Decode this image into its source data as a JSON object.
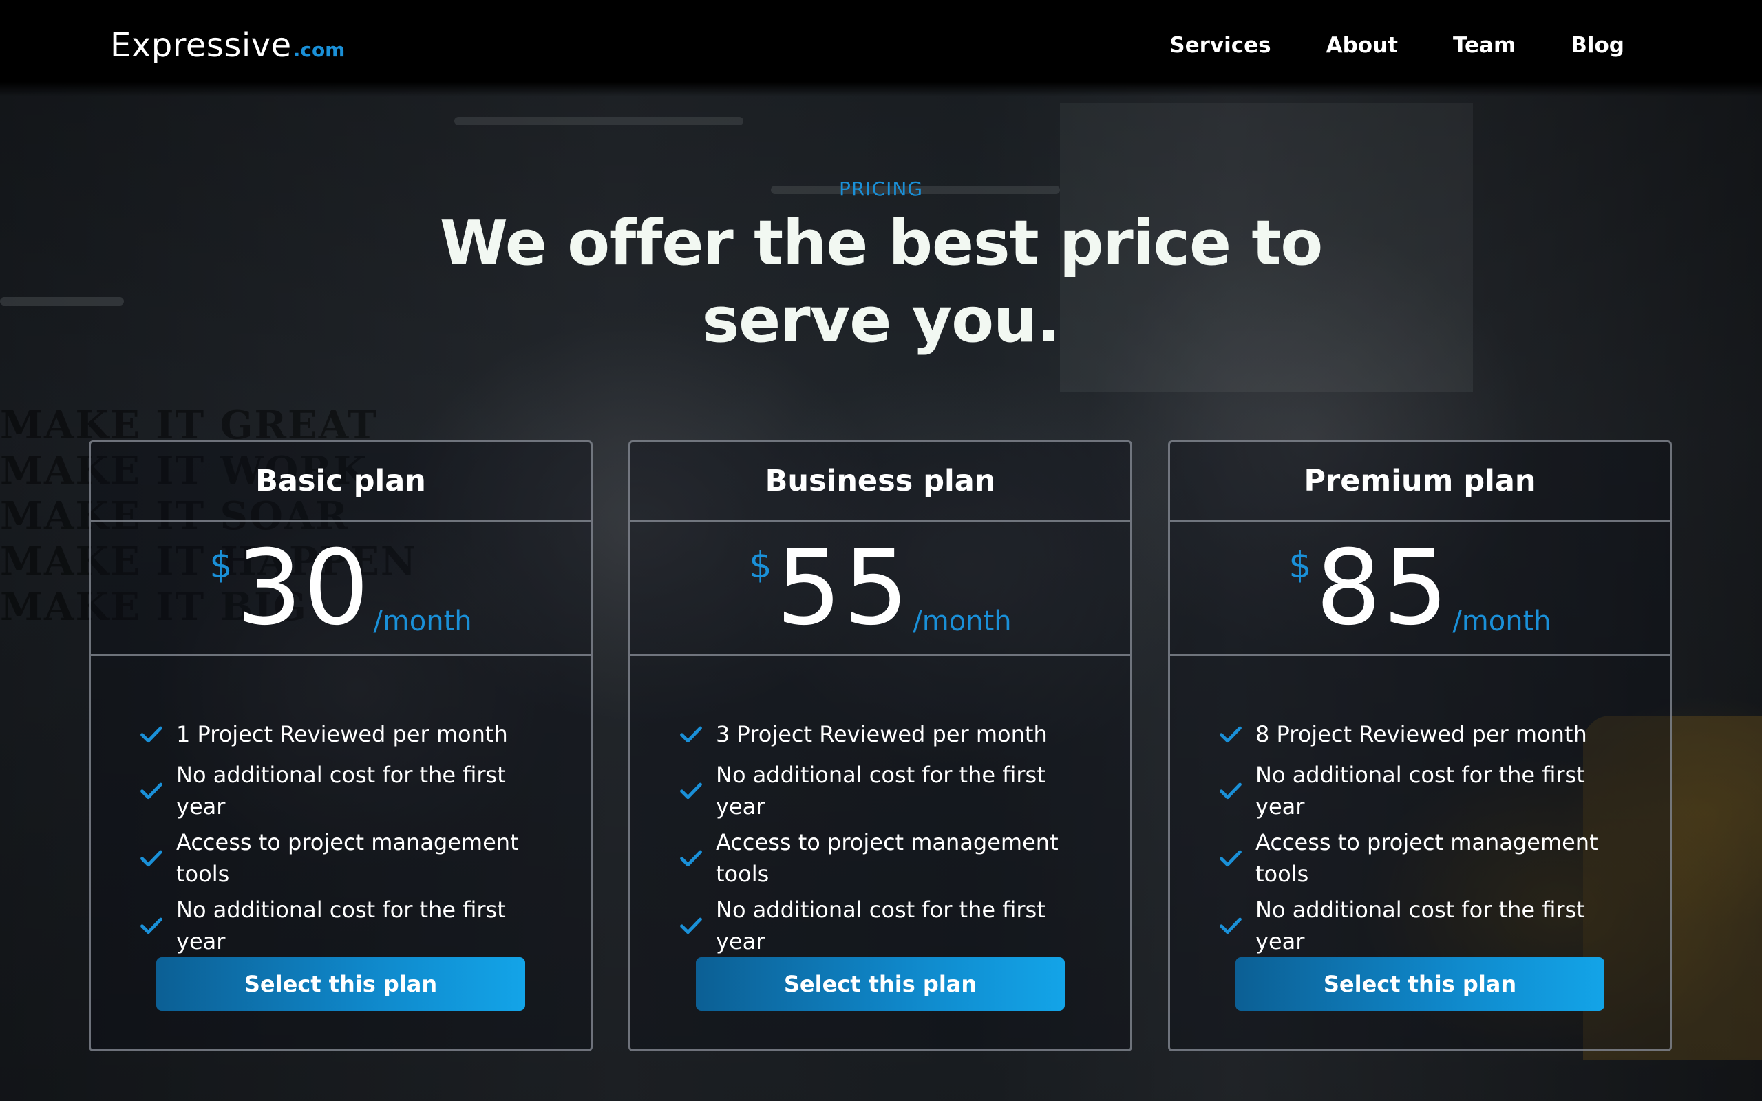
{
  "brand": {
    "name": "Expressive",
    "tld": ".com"
  },
  "nav": [
    {
      "label": "Services"
    },
    {
      "label": "About"
    },
    {
      "label": "Team"
    },
    {
      "label": "Blog"
    }
  ],
  "hero": {
    "eyebrow": "PRICING",
    "headline": "We offer the best price to serve you."
  },
  "colors": {
    "accent": "#1a90d8",
    "headline": "#f2f8f2"
  },
  "plans": [
    {
      "title": "Basic plan",
      "currency": "$",
      "amount": "30",
      "period": "/month",
      "features": [
        "1 Project Reviewed per month",
        "No additional cost for the first year",
        "Access to project management tools",
        "No additional cost for the first year"
      ],
      "button": "Select this plan"
    },
    {
      "title": "Business plan",
      "currency": "$",
      "amount": "55",
      "period": "/month",
      "features": [
        "3 Project Reviewed per month",
        "No additional cost for the first year",
        "Access to project management tools",
        "No additional cost for the first year"
      ],
      "button": "Select this plan"
    },
    {
      "title": "Premium plan",
      "currency": "$",
      "amount": "85",
      "period": "/month",
      "features": [
        "8 Project Reviewed per month",
        "No additional cost for the first year",
        "Access to project management tools",
        "No additional cost for the first year"
      ],
      "button": "Select this plan"
    }
  ],
  "icons": {
    "feature": "check-icon"
  }
}
